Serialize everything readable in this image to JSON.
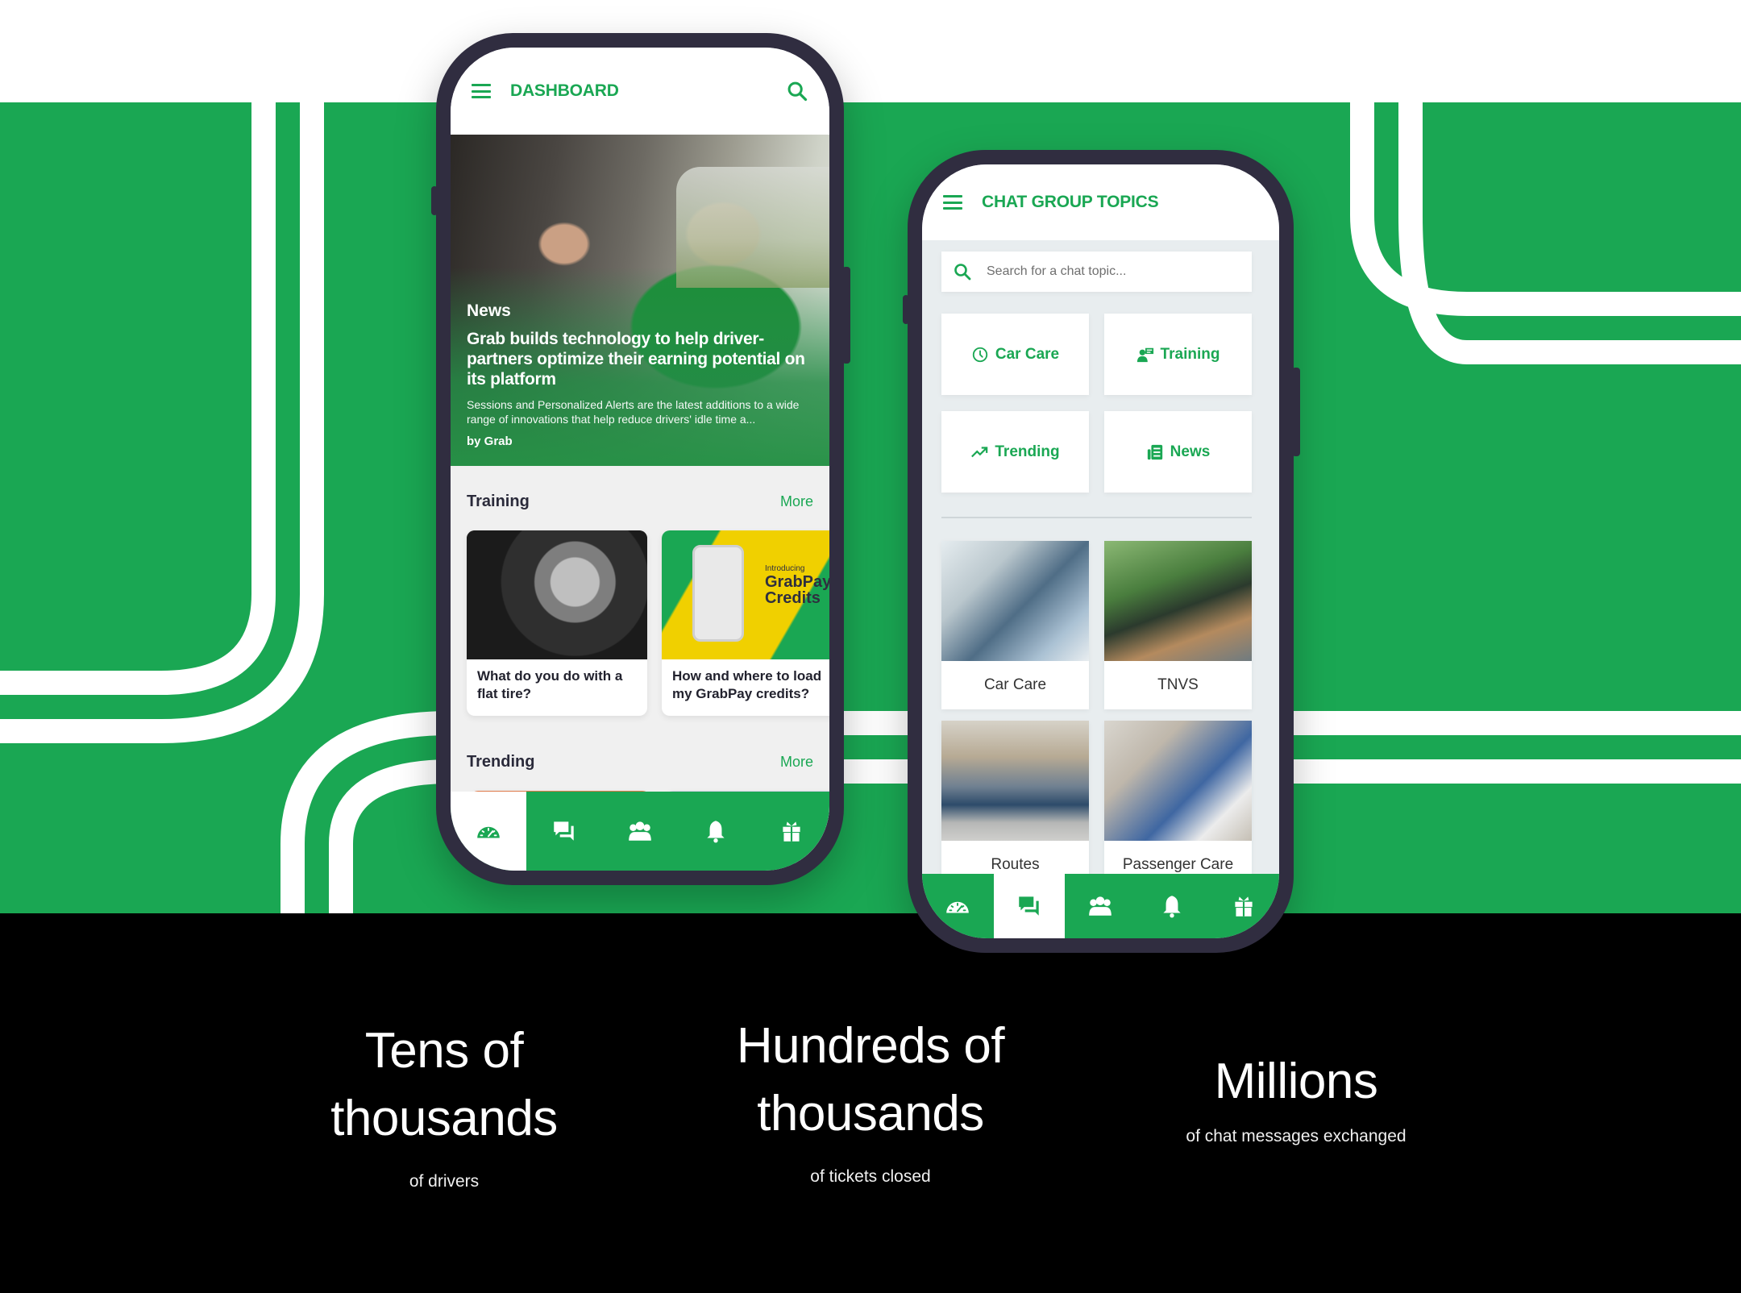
{
  "colors": {
    "brand_green": "#1aa753",
    "phone_frame": "#302d40",
    "background_white": "#ffffff",
    "background_black": "#000000"
  },
  "dashboard_phone": {
    "title": "DASHBOARD",
    "menu_icon": "hamburger-menu-icon",
    "search_icon": "search-icon",
    "hero": {
      "category": "News",
      "headline": "Grab builds technology to help driver-partners optimize their earning potential on its platform",
      "summary": "Sessions and Personalized Alerts are the latest additions to a wide range of innovations that help reduce drivers' idle time a...",
      "byline": "by Grab"
    },
    "training": {
      "label": "Training",
      "more": "More",
      "cards": [
        {
          "title": "What do you do with a flat tire?",
          "image": "tire-change-photo"
        },
        {
          "title": "How and where to load my GrabPay credits?",
          "image": "grabpay-credits-promo",
          "promo_intro": "Introducing",
          "promo_title_1": "GrabPay",
          "promo_title_2": "Credits"
        }
      ]
    },
    "trending": {
      "label": "Trending",
      "more": "More",
      "cards": [
        {
          "image": "highway-sunset-photo"
        },
        {
          "image": "building-photo"
        }
      ]
    },
    "tabs": [
      {
        "icon": "speedometer-icon",
        "label": "dashboard",
        "active": true
      },
      {
        "icon": "chat-bubbles-icon",
        "label": "chat",
        "active": false
      },
      {
        "icon": "group-icon",
        "label": "community",
        "active": false
      },
      {
        "icon": "bell-icon",
        "label": "notifications",
        "active": false
      },
      {
        "icon": "gift-icon",
        "label": "rewards",
        "active": false
      }
    ]
  },
  "chat_phone": {
    "title": "CHAT GROUP TOPICS",
    "menu_icon": "hamburger-menu-icon",
    "search": {
      "placeholder": "Search for a chat topic...",
      "value": ""
    },
    "topics": [
      {
        "label": "Car Care",
        "icon": "clock-icon"
      },
      {
        "label": "Training",
        "icon": "trainer-icon"
      },
      {
        "label": "Trending",
        "icon": "trending-up-icon"
      },
      {
        "label": "News",
        "icon": "newspaper-icon"
      }
    ],
    "groups": [
      {
        "name": "Car Care",
        "image": "driver-in-car-photo"
      },
      {
        "name": "TNVS",
        "image": "delivery-rider-photo"
      },
      {
        "name": "Routes",
        "image": "car-at-terminal-photo"
      },
      {
        "name": "Passenger Care",
        "image": "passengers-in-car-photo"
      }
    ],
    "tabs": [
      {
        "icon": "speedometer-icon",
        "label": "dashboard",
        "active": false
      },
      {
        "icon": "chat-bubbles-icon",
        "label": "chat",
        "active": true
      },
      {
        "icon": "group-icon",
        "label": "community",
        "active": false
      },
      {
        "icon": "bell-icon",
        "label": "notifications",
        "active": false
      },
      {
        "icon": "gift-icon",
        "label": "rewards",
        "active": false
      }
    ]
  },
  "stats": [
    {
      "headline_1": "Tens of",
      "headline_2": "thousands",
      "caption": "of drivers"
    },
    {
      "headline_1": "Hundreds of",
      "headline_2": "thousands",
      "caption": "of tickets closed"
    },
    {
      "headline_1": "Millions",
      "headline_2": "",
      "caption": "of chat messages exchanged"
    }
  ]
}
